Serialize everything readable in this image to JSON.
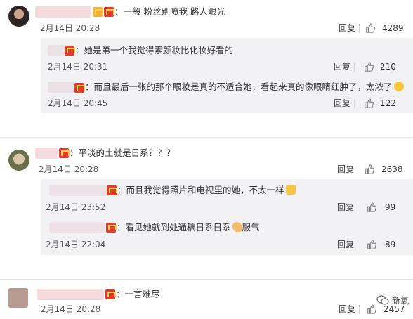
{
  "comments": [
    {
      "text": "：一般 粉丝别喷我 路人眼光",
      "date": "2月14日 20:28",
      "reply_label": "回复",
      "likes": "4289",
      "replies": [
        {
          "text": "：她是第一个我觉得素颜妆比化妆好看的",
          "date": "2月14日 20:31",
          "reply_label": "回复",
          "likes": "210"
        },
        {
          "text": "：而且最后一张的那个眼妆是真的不适合她，看起来真的像眼睛红肿了，太浓了",
          "date": "2月14日 20:45",
          "reply_label": "回复",
          "likes": "122"
        }
      ]
    },
    {
      "text": "：平淡的土就是日系？？？",
      "date": "2月14日 20:28",
      "reply_label": "回复",
      "likes": "2638",
      "replies": [
        {
          "text": "：而且我觉得照片和电视里的她，不太一样",
          "date": "2月14日 23:52",
          "reply_label": "回复",
          "likes": "99"
        },
        {
          "text": "：看见她就到处通稿日系日系",
          "text_suffix": "服气",
          "date": "2月14日 22:04",
          "reply_label": "回复",
          "likes": "89"
        }
      ]
    },
    {
      "text": "：一言难尽",
      "date": "2月14日 20:28",
      "reply_label": "回复",
      "likes": "2457"
    }
  ],
  "watermark": "新氧",
  "icons": {
    "like": "thumbs-up-icon",
    "badge": "vip-crown-badge-icon"
  },
  "colors": {
    "badge": "#e43a2e",
    "reply_box": "#f2f2f5",
    "blur": "#f4d6da"
  }
}
